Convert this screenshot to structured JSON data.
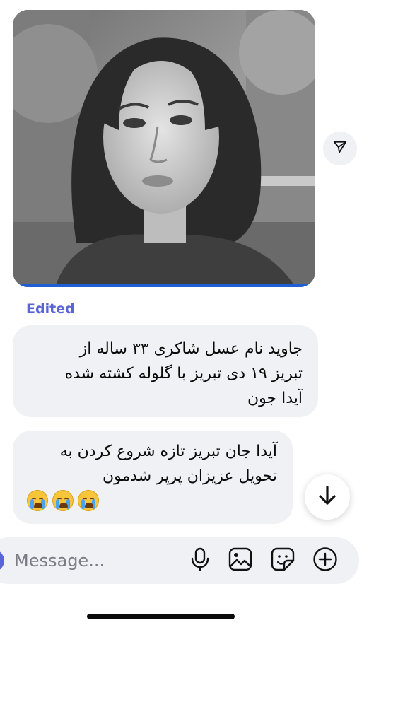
{
  "message_photo": {
    "alt": "black and white portrait photo"
  },
  "edited_label": "Edited",
  "messages": [
    {
      "text": "جاوید نام عسل شاکری ۳۳ ساله از\nتبریز ۱۹ دی تبریز با گلوله کشته شده\nآیدا جون"
    },
    {
      "text": "آیدا جان تبریز تازه شروع کردن به\nتحویل عزیزان پرپر شدمون",
      "emojis": [
        "😭",
        "😭",
        "😭"
      ]
    }
  ],
  "composer": {
    "placeholder": "Message..."
  },
  "colors": {
    "bubble": "#eff1f4",
    "edited": "#5a63d8",
    "photo_bar": "#1f5fd6"
  },
  "icons": [
    "share-icon",
    "arrow-down-icon",
    "microphone-icon",
    "image-icon",
    "sticker-icon",
    "plus-circle-icon"
  ]
}
